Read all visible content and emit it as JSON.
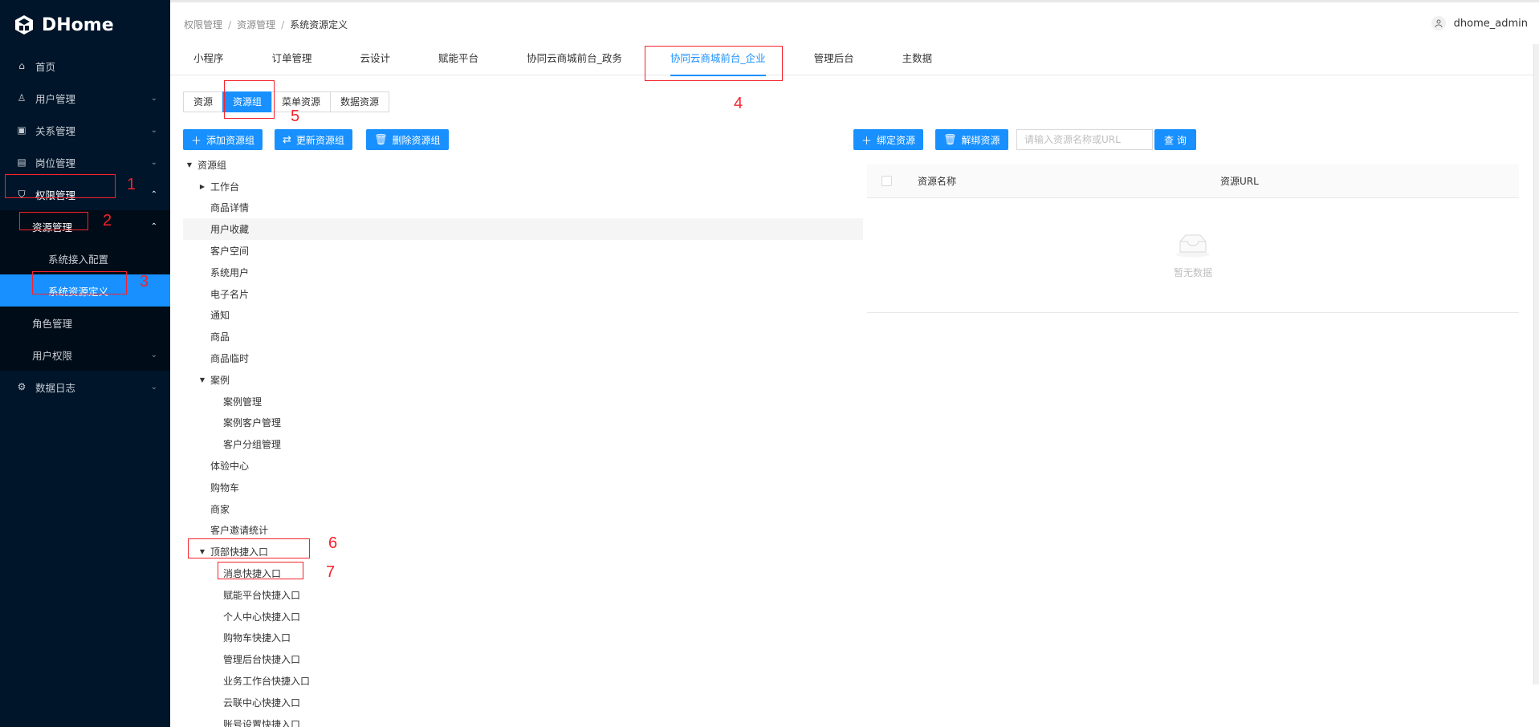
{
  "app": {
    "logo_text": "DHome"
  },
  "sidebar": {
    "items": [
      {
        "label": "首页",
        "icon": "home-icon"
      },
      {
        "label": "用户管理",
        "icon": "user-icon"
      },
      {
        "label": "关系管理",
        "icon": "relation-icon"
      },
      {
        "label": "岗位管理",
        "icon": "position-icon"
      },
      {
        "label": "权限管理",
        "icon": "shield-icon"
      },
      {
        "label": "数据日志",
        "icon": "log-icon"
      }
    ],
    "submenu": {
      "resource_management": "资源管理",
      "system_access_config": "系统接入配置",
      "system_resource_definition": "系统资源定义",
      "role_management": "角色管理",
      "user_permissions": "用户权限"
    }
  },
  "header": {
    "breadcrumb": [
      "权限管理",
      "资源管理",
      "系统资源定义"
    ],
    "username": "dhome_admin"
  },
  "tabs": [
    "小程序",
    "订单管理",
    "云设计",
    "赋能平台",
    "协同云商城前台_政务",
    "协同云商城前台_企业",
    "管理后台",
    "主数据"
  ],
  "active_tab": "协同云商城前台_企业",
  "segment": [
    "资源",
    "资源组",
    "菜单资源",
    "数据资源"
  ],
  "active_segment": "资源组",
  "actions": {
    "add_group": "添加资源组",
    "update_group": "更新资源组",
    "delete_group": "删除资源组",
    "bind_resource": "绑定资源",
    "unbind_resource": "解绑资源",
    "search_placeholder": "请输入资源名称或URL",
    "search_button": "查 询"
  },
  "tree": {
    "root": "资源组",
    "nodes": [
      {
        "label": "工作台"
      },
      {
        "label": "商品详情"
      },
      {
        "label": "用户收藏"
      },
      {
        "label": "客户空间"
      },
      {
        "label": "系统用户"
      },
      {
        "label": "电子名片"
      },
      {
        "label": "通知"
      },
      {
        "label": "商品"
      },
      {
        "label": "商品临时"
      },
      {
        "label": "案例"
      },
      {
        "label": "案例管理"
      },
      {
        "label": "案例客户管理"
      },
      {
        "label": "客户分组管理"
      },
      {
        "label": "体验中心"
      },
      {
        "label": "购物车"
      },
      {
        "label": "商家"
      },
      {
        "label": "客户邀请统计"
      },
      {
        "label": "顶部快捷入口"
      },
      {
        "label": "消息快捷入口"
      },
      {
        "label": "赋能平台快捷入口"
      },
      {
        "label": "个人中心快捷入口"
      },
      {
        "label": "购物车快捷入口"
      },
      {
        "label": "管理后台快捷入口"
      },
      {
        "label": "业务工作台快捷入口"
      },
      {
        "label": "云联中心快捷入口"
      },
      {
        "label": "账号设置快捷入口"
      }
    ]
  },
  "table": {
    "columns": [
      "资源名称",
      "资源URL"
    ],
    "empty_text": "暂无数据"
  },
  "annotations": [
    "1",
    "2",
    "3",
    "4",
    "5",
    "6",
    "7"
  ],
  "colors": {
    "sidebar_bg": "#001529",
    "primary": "#1890ff",
    "annotation_red": "#f5222d"
  }
}
